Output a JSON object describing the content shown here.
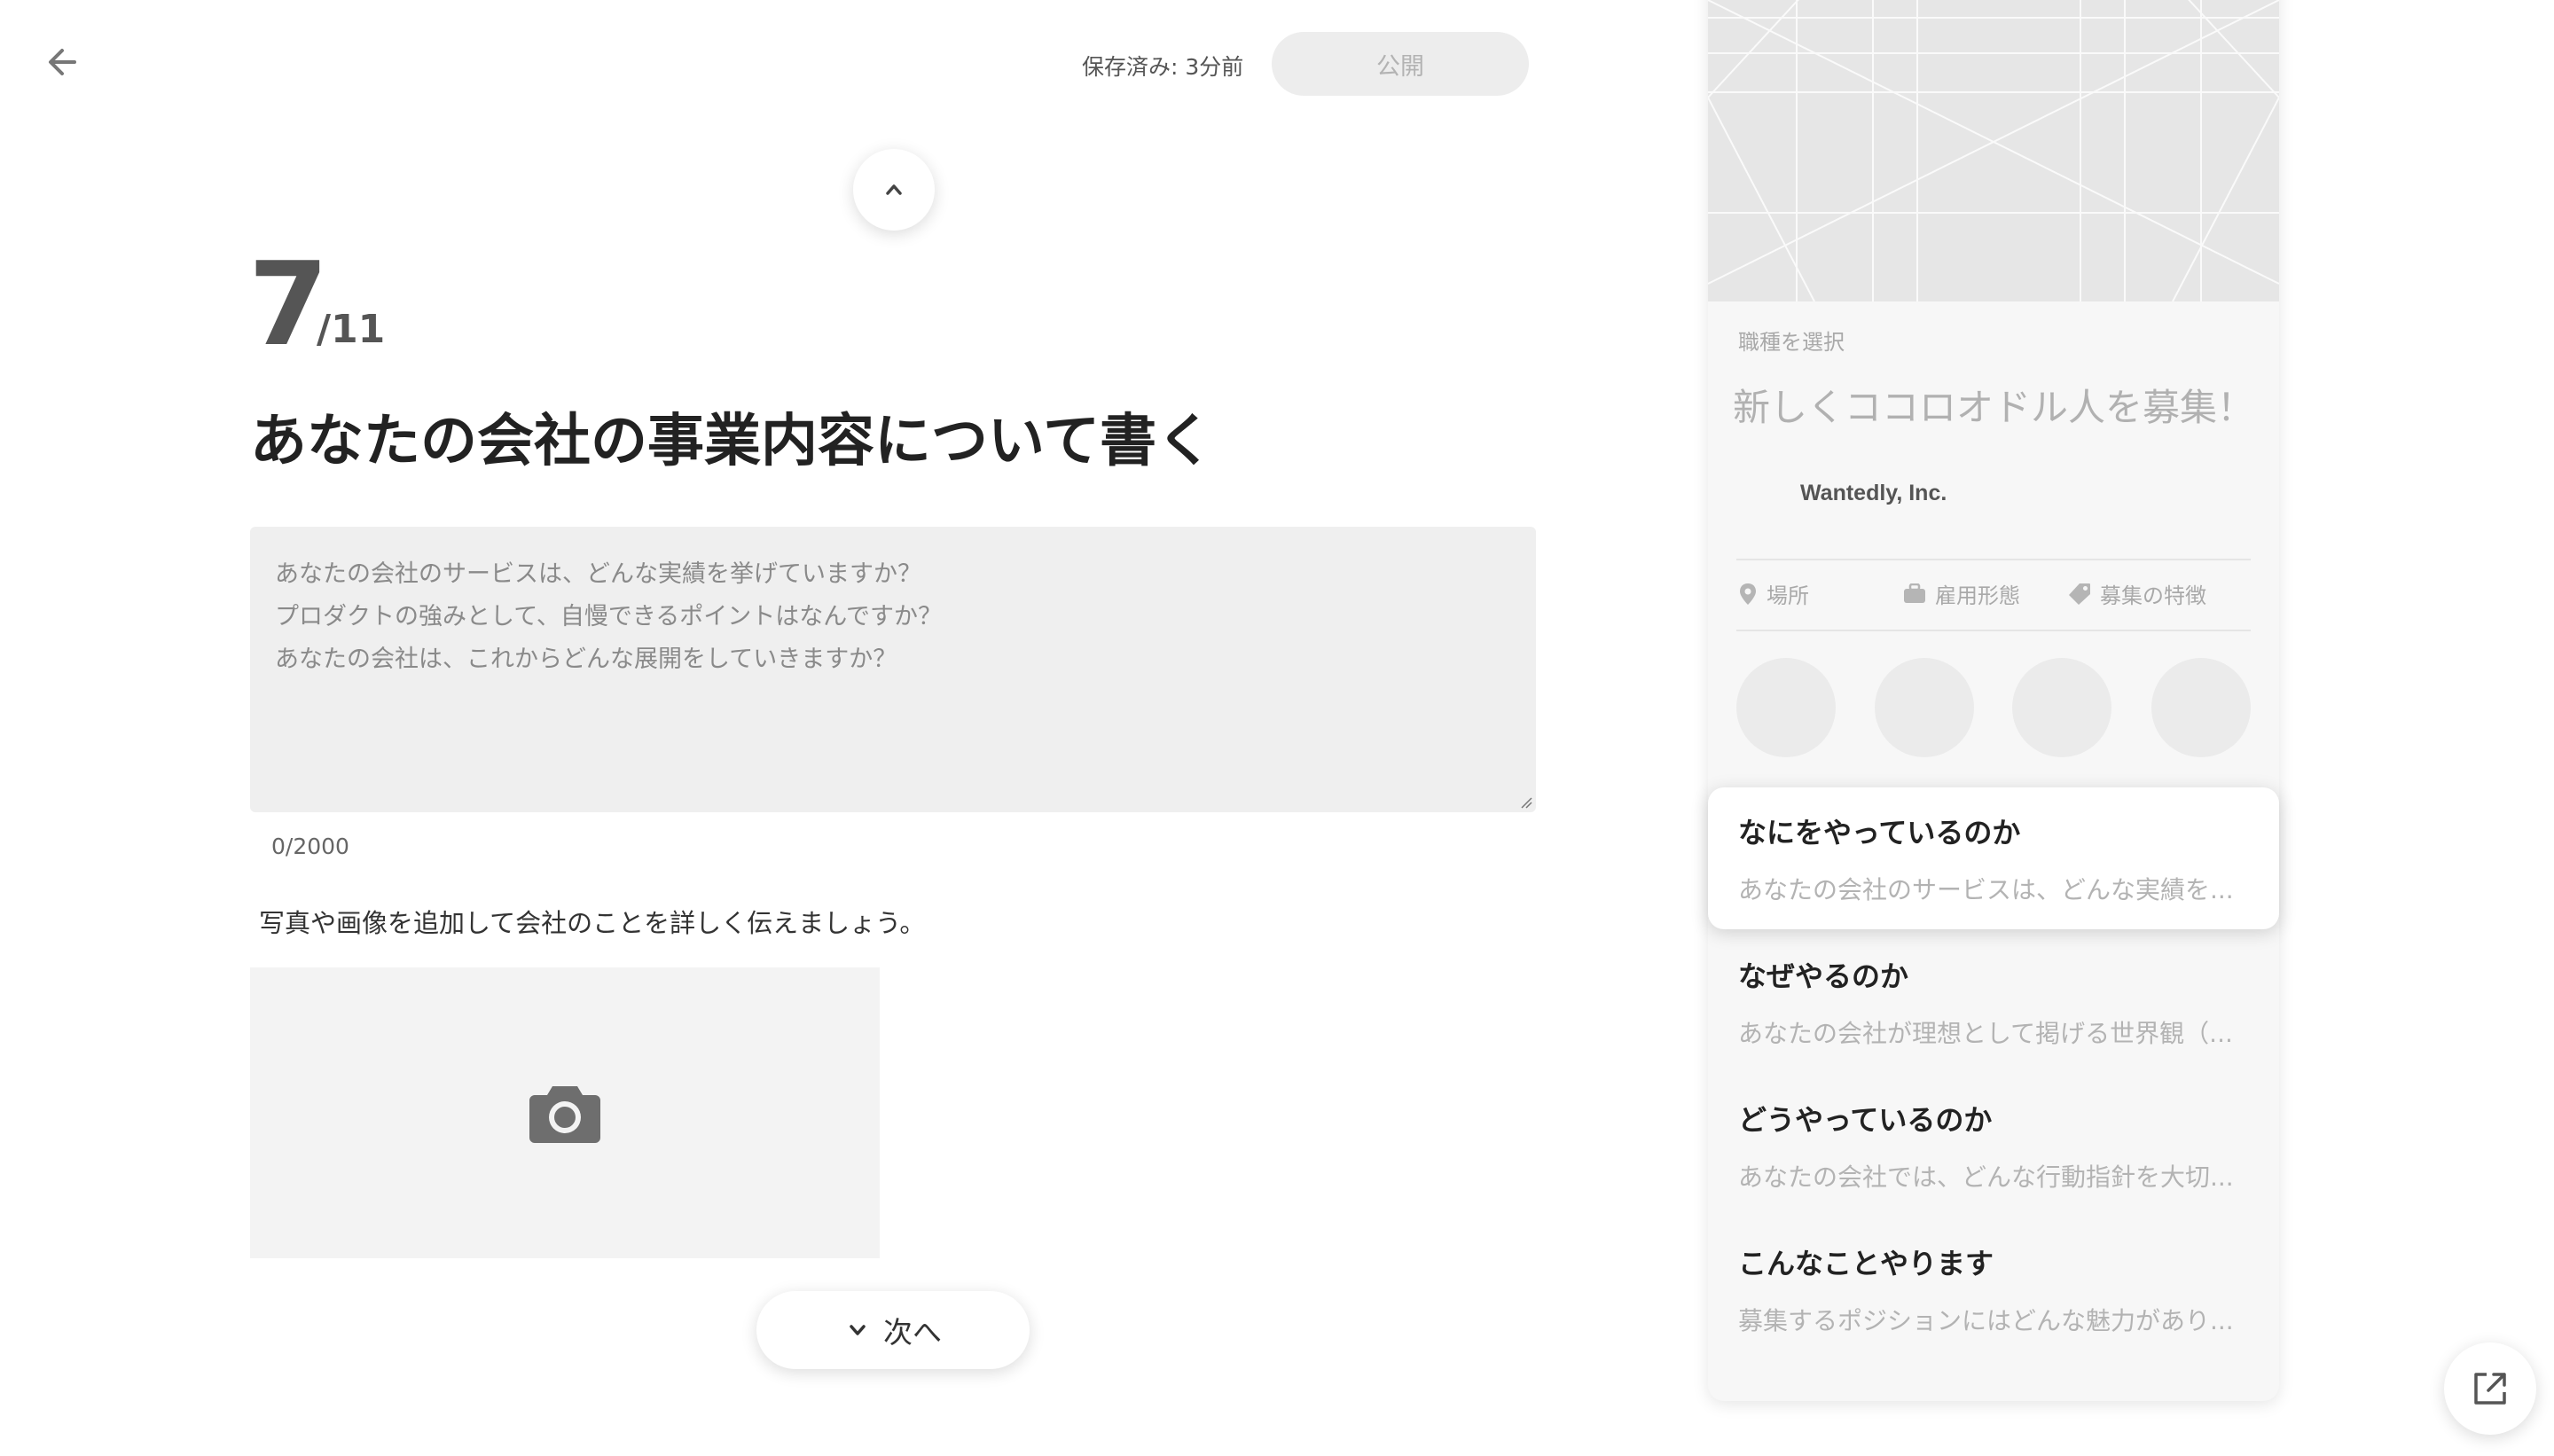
{
  "header": {
    "saved_status": "保存済み: 3分前",
    "publish_label": "公開"
  },
  "step": {
    "current": "7",
    "total": "/11"
  },
  "page_title": "あなたの会社の事業内容について書く",
  "description_field": {
    "value": "",
    "placeholder_lines": [
      "あなたの会社のサービスは、どんな実績を挙げていますか？",
      "プロダクトの強みとして、自慢できるポイントはなんですか？",
      "あなたの会社は、これからどんな展開をしていきますか？"
    ],
    "char_count": "0/2000"
  },
  "photo": {
    "hint": "写真や画像を追加して会社のことを詳しく伝えましょう。",
    "icon": "camera-icon"
  },
  "next_label": "次へ",
  "preview": {
    "job_category_placeholder": "職種を選択",
    "headline": "新しくココロオドル人を募集！",
    "company": "Wantedly, Inc.",
    "meta": [
      {
        "icon": "map-pin-icon",
        "label": "場所"
      },
      {
        "icon": "briefcase-icon",
        "label": "雇用形態"
      },
      {
        "icon": "tag-icon",
        "label": "募集の特徴"
      }
    ],
    "sections": [
      {
        "title": "なにをやっているのか",
        "text": "あなたの会社のサービスは、どんな実績を..."
      },
      {
        "title": "なぜやるのか",
        "text": "あなたの会社が理想として掲げる世界観（..."
      },
      {
        "title": "どうやっているのか",
        "text": "あなたの会社では、どんな行動指針を大切..."
      },
      {
        "title": "こんなことやります",
        "text": "募集するポジションにはどんな魅力があり..."
      }
    ]
  },
  "colors": {
    "accent_disabled": "#ededed",
    "text_primary": "#222222",
    "text_muted": "#b3b3b3"
  }
}
